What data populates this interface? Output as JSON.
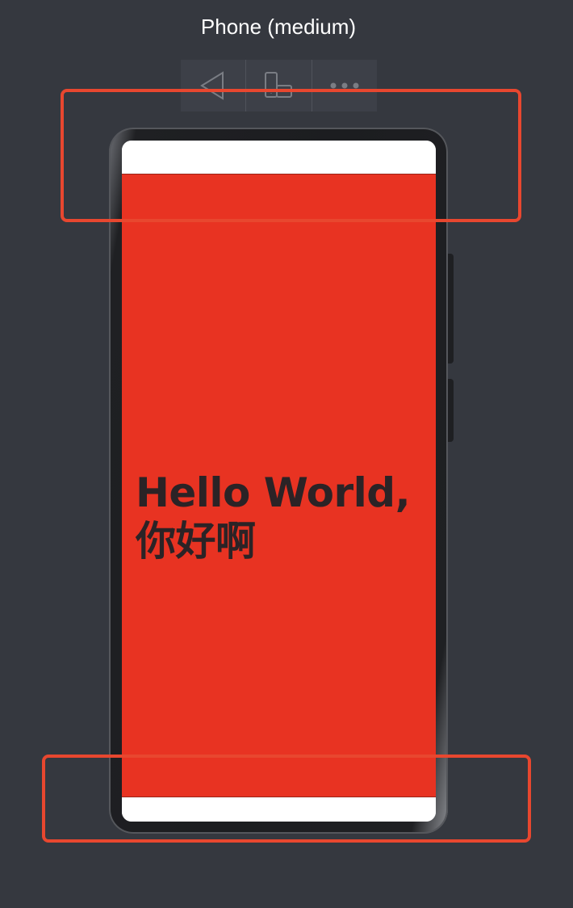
{
  "device": {
    "title": "Phone (medium)"
  },
  "toolbar": {
    "buttons": [
      {
        "name": "back",
        "icon": "triangle-left-icon"
      },
      {
        "name": "rotate",
        "icon": "device-rotate-icon"
      },
      {
        "name": "more",
        "icon": "more-dots-icon"
      }
    ]
  },
  "screen": {
    "text_line1": "Hello World,",
    "text_line2": "你好啊",
    "background_color": "#e83322",
    "text_color": "#2b2326"
  },
  "annotations": {
    "highlight_color": "#e8472f"
  }
}
